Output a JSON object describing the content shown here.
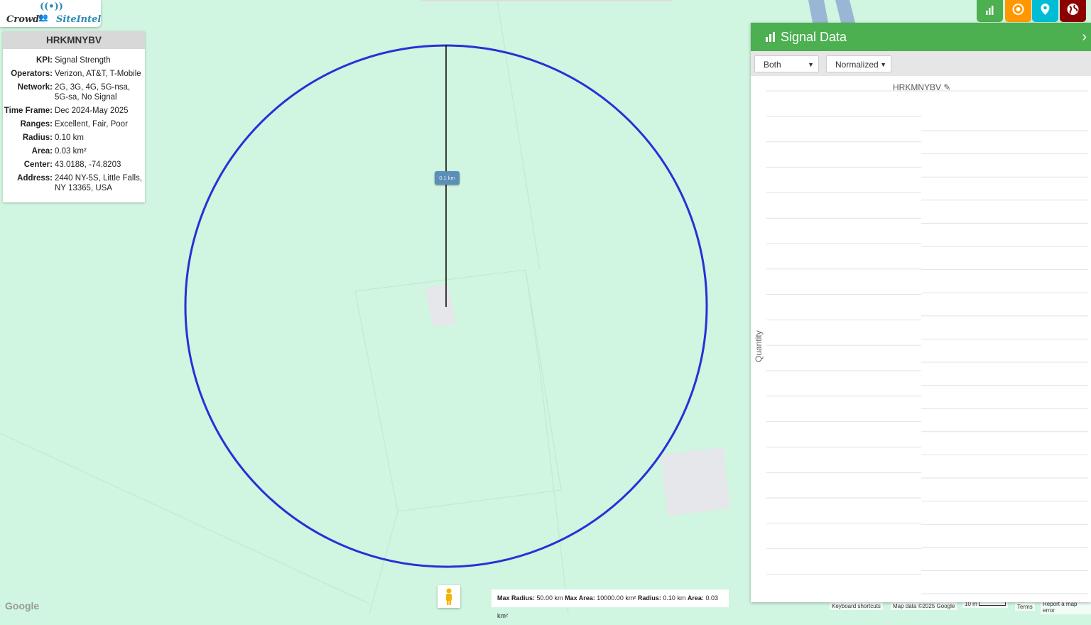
{
  "app": {
    "logo_left": "Crowd",
    "logo_right": "SiteIntel"
  },
  "site_info": {
    "title": "HRKMNYBV",
    "rows": [
      {
        "key": "KPI:",
        "value": "Signal Strength"
      },
      {
        "key": "Operators:",
        "value": "Verizon, AT&T, T-Mobile"
      },
      {
        "key": "Network:",
        "value": "2G, 3G, 4G, 5G-nsa, 5G-sa, No Signal"
      },
      {
        "key": "Time Frame:",
        "value": "Dec 2024-May 2025"
      },
      {
        "key": "Ranges:",
        "value": "Excellent, Fair, Poor"
      },
      {
        "key": "Radius:",
        "value": "0.10 km"
      },
      {
        "key": "Area:",
        "value": "0.03 km²"
      },
      {
        "key": "Center:",
        "value": "43.0188, -74.8203"
      },
      {
        "key": "Address:",
        "value": "2440 NY-5S, Little Falls, NY 13365, USA"
      }
    ]
  },
  "map": {
    "radius_label": "0.1 km",
    "circle_color": "#2b2fd6",
    "limits": {
      "max_radius_key": "Max Radius:",
      "max_radius_val": "50.00 km",
      "max_area_key": "Max Area:",
      "max_area_val": "10000.00 km²",
      "radius_key": "Radius:",
      "radius_val": "0.10 km",
      "area_key": "Area:",
      "area_val": "0.03 km²"
    },
    "google_logo": "Google",
    "keyboard_shortcuts": "Keyboard shortcuts",
    "map_data": "Map data ©2025 Google",
    "scale": "10 m",
    "terms": "Terms",
    "report": "Report a map error"
  },
  "top_buttons": [
    {
      "name": "signal-data-button",
      "color": "#4caf50",
      "icon": "bar-chart-icon"
    },
    {
      "name": "target-button",
      "color": "#ff9800",
      "icon": "target-icon"
    },
    {
      "name": "location-button",
      "color": "#00bcd4",
      "icon": "map-pin-icon"
    },
    {
      "name": "globe-button",
      "color": "#8b0000",
      "icon": "globe-icon"
    }
  ],
  "panel": {
    "title": "Signal Data",
    "select_type": "Both",
    "select_mode": "Normalized",
    "chart_title": "HRKMNYBV",
    "ylabel": "Quantity",
    "accent": "#4caf50"
  }
}
